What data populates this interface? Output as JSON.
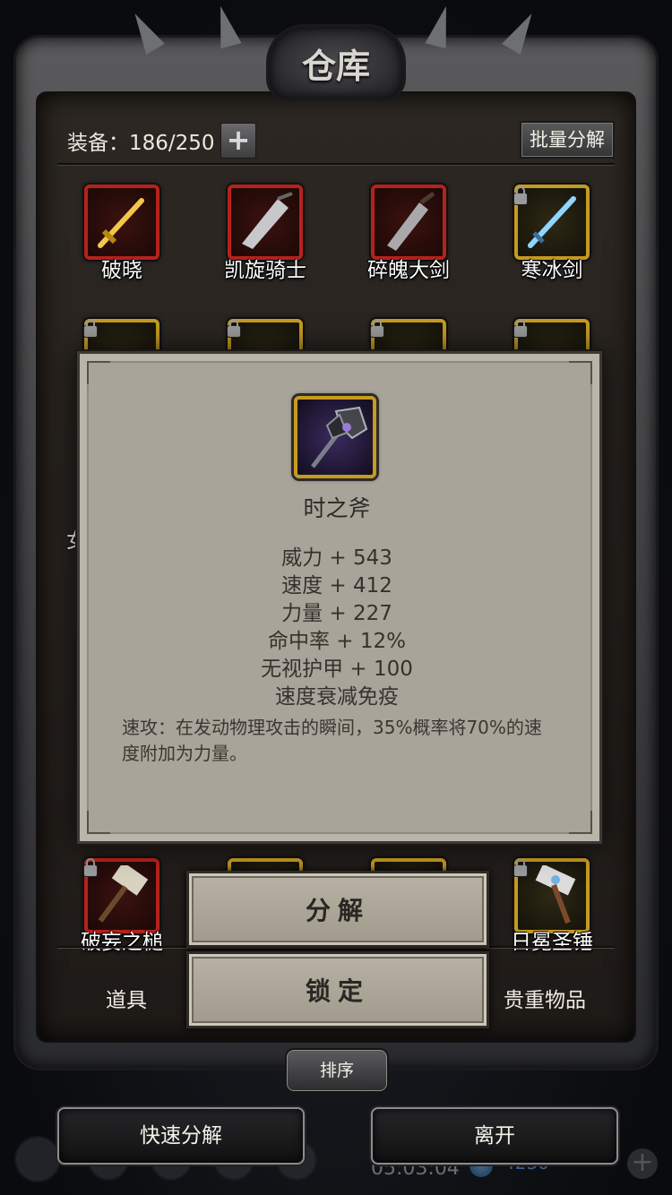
{
  "window": {
    "title": "仓库"
  },
  "header": {
    "equip_label": "装备：186/250",
    "plus_icon": "plus-icon",
    "bulk_decompose": "批量分解"
  },
  "grid_top": [
    {
      "name": "破晓",
      "rarity": "red"
    },
    {
      "name": "凯旋骑士",
      "rarity": "red"
    },
    {
      "name": "碎魄大剑",
      "rarity": "red"
    },
    {
      "name": "寒冰剑",
      "rarity": "gold",
      "locked": true
    }
  ],
  "grid_bottom": [
    {
      "name": "破妄之槌",
      "rarity": "red",
      "locked": true
    },
    {
      "name": "日冕圣锤",
      "rarity": "gold",
      "locked": true
    }
  ],
  "partial_text": {
    "left_glyph": "女"
  },
  "popup": {
    "item_name": "时之斧",
    "stats": [
      "威力 + 543",
      "速度 + 412",
      "力量 + 227",
      "命中率 + 12%",
      "无视护甲 + 100",
      "速度衰减免疫"
    ],
    "description": "速攻：在发动物理攻击的瞬间，35%概率将70%的速度附加为力量。"
  },
  "actions": {
    "decompose": "分解",
    "lock": "锁定"
  },
  "tabs": {
    "items": "道具",
    "valuables": "贵重物品"
  },
  "sort_label": "排序",
  "bottom": {
    "quick_decompose": "快速分解",
    "leave": "离开",
    "time": "05:03:04",
    "currency": "4230"
  },
  "colors": {
    "rarity_red": "#b5221c",
    "rarity_gold": "#c49a22",
    "popup_bg": "#a8a49a"
  }
}
